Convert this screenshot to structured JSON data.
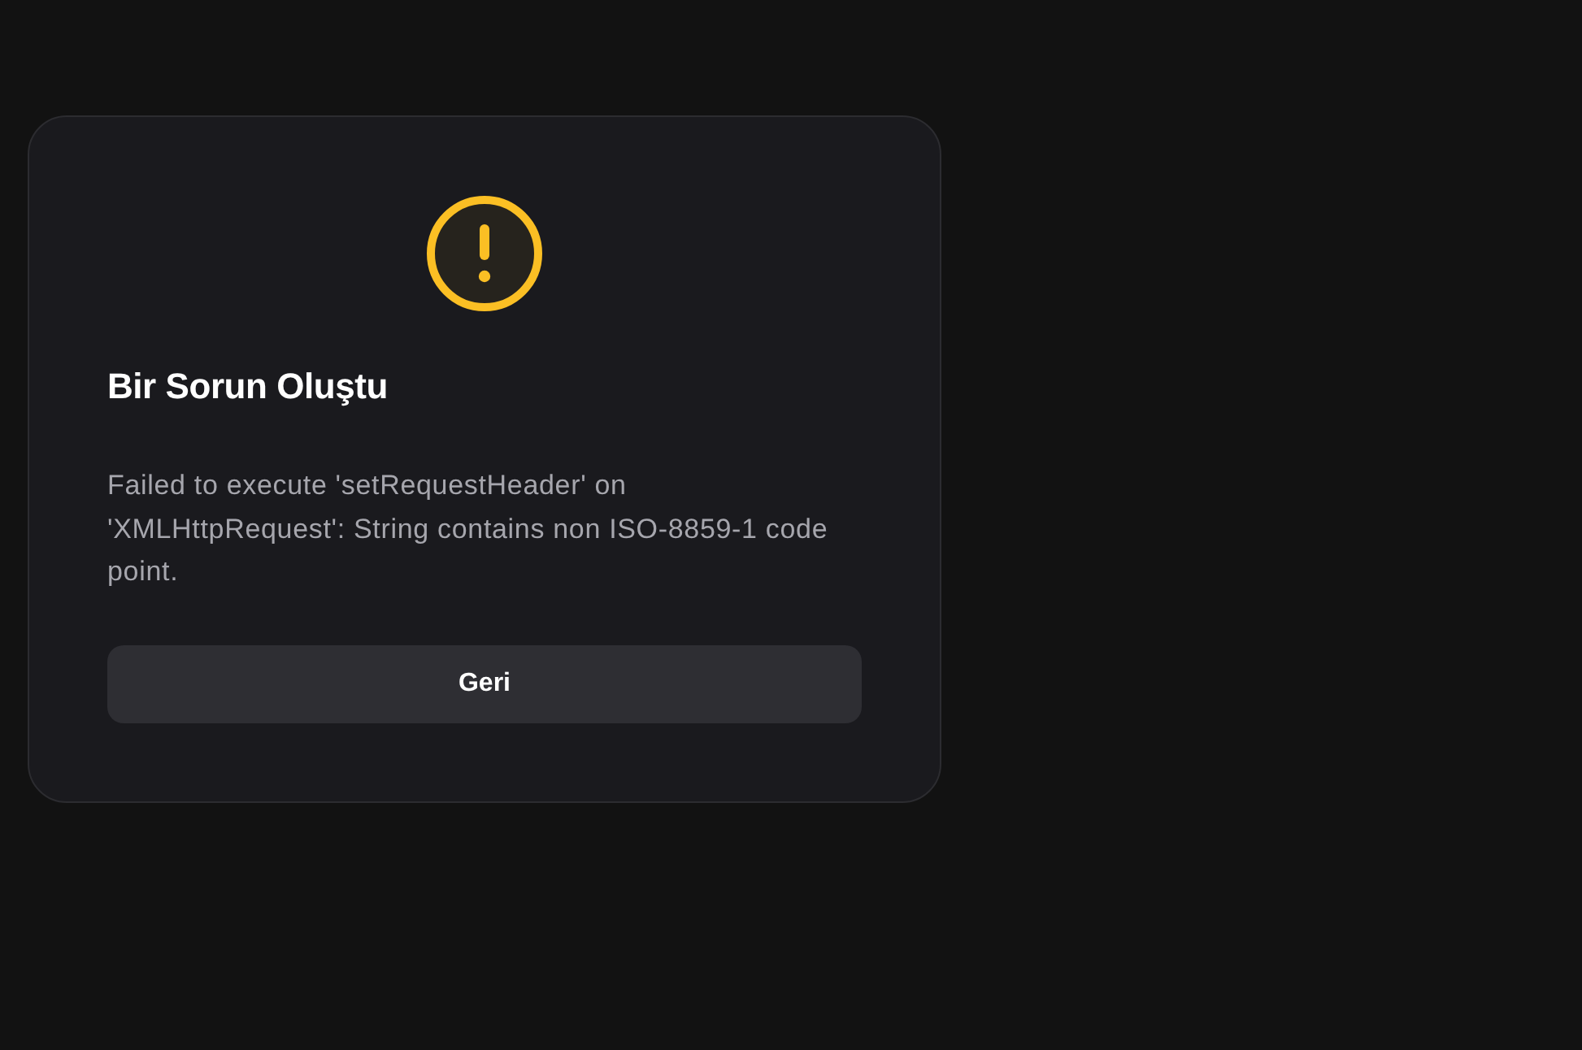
{
  "dialog": {
    "title": "Bir Sorun Oluştu",
    "message": "Failed to execute 'setRequestHeader' on 'XMLHttpRequest': String contains non ISO-8859-1 code point.",
    "button": "Geri"
  }
}
